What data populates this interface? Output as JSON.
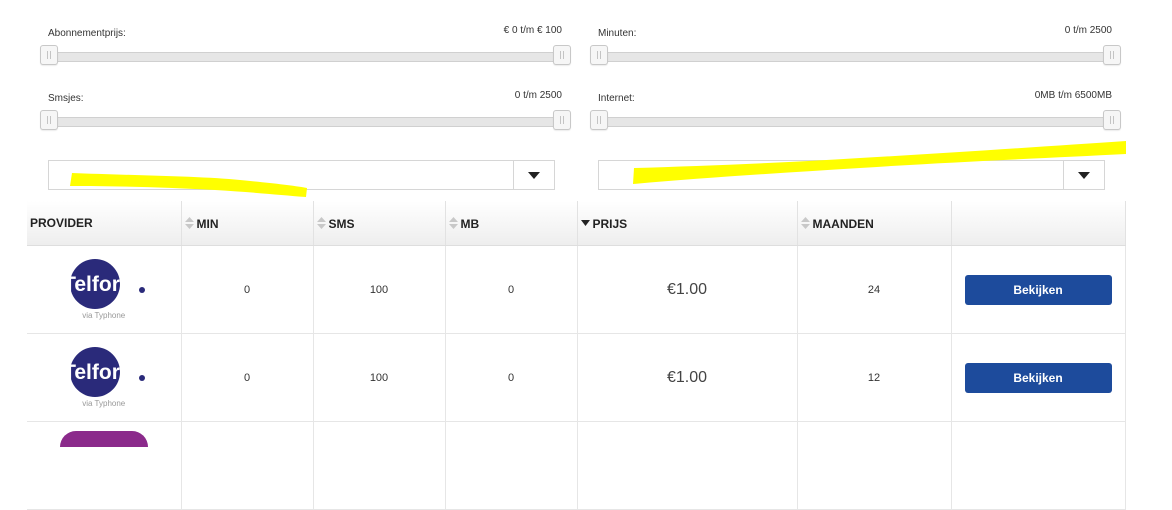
{
  "filters": {
    "price": {
      "label": "Abonnementprijs:",
      "range": "€ 0 t/m € 100"
    },
    "minutes": {
      "label": "Minuten:",
      "range": "0 t/m 2500"
    },
    "sms": {
      "label": "Smsjes:",
      "range": "0 t/m 2500"
    },
    "internet": {
      "label": "Internet:",
      "range": "0MB t/m 6500MB"
    }
  },
  "selects": {
    "left_value": "",
    "right_value": ""
  },
  "table": {
    "headers": {
      "provider": "PROVIDER",
      "min": "MIN",
      "sms": "SMS",
      "mb": "MB",
      "price": "PRIJS",
      "months": "MAANDEN"
    },
    "rows": [
      {
        "logo_text": "Telfort",
        "via": "via Typhone",
        "min": "0",
        "sms": "100",
        "mb": "0",
        "price": "€1.00",
        "months": "24",
        "button": "Bekijken"
      },
      {
        "logo_text": "Telfort",
        "via": "via Typhone",
        "min": "0",
        "sms": "100",
        "mb": "0",
        "price": "€1.00",
        "months": "12",
        "button": "Bekijken"
      }
    ]
  },
  "colors": {
    "button": "#1d4b9c",
    "logo_circle": "#2a2a7a",
    "highlight": "#ffff00",
    "next_logo": "#8b2a8b"
  }
}
